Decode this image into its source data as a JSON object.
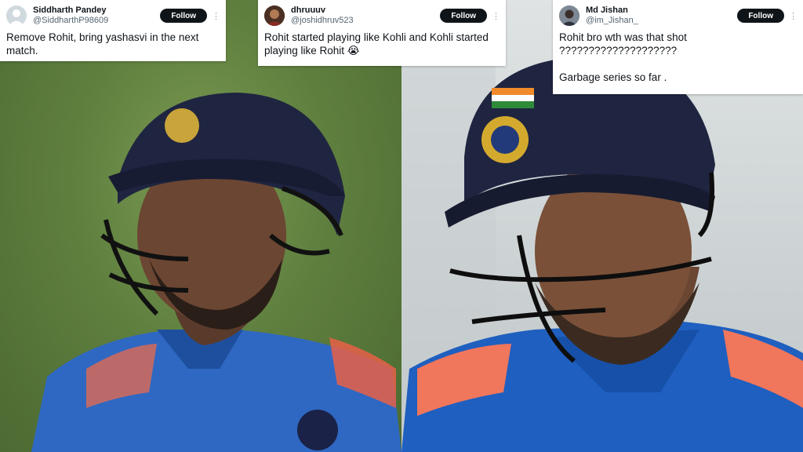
{
  "tweets": [
    {
      "name": "Siddharth Pandey",
      "handle": "@SiddharthP98609",
      "follow_label": "Follow",
      "text": "Remove Rohit, bring yashasvi in the next match."
    },
    {
      "name": "dhruuuv",
      "handle": "@joshidhruv523",
      "follow_label": "Follow",
      "text": "Rohit started playing like Kohli and Kohli started playing like Rohit 😭"
    },
    {
      "name": "Md Jishan",
      "handle": "@im_Jishan_",
      "follow_label": "Follow",
      "text": "Rohit bro wth was that shot ????????????????????\n\nGarbage series so far ."
    }
  ],
  "colors": {
    "follow_button": "#0f1419",
    "handle_text": "#536471",
    "field_green": "#5f7f3f",
    "helmet_navy": "#1f2540",
    "jersey_blue": "#1f5fbf"
  },
  "icons": [
    "default-avatar-icon",
    "user-avatar-icon",
    "more-options-icon"
  ]
}
